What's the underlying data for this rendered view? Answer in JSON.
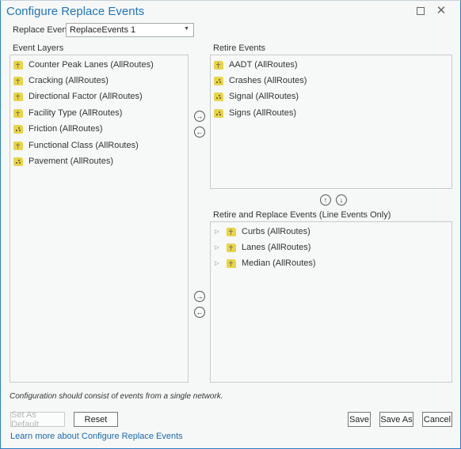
{
  "window": {
    "title": "Configure Replace Events"
  },
  "replace_events": {
    "label": "Replace Events",
    "selected": "ReplaceEvents 1"
  },
  "event_layers": {
    "header": "Event Layers",
    "items": [
      {
        "label": "Counter Peak Lanes (AllRoutes)",
        "icon": "line-event-layer-icon"
      },
      {
        "label": "Cracking (AllRoutes)",
        "icon": "line-event-layer-icon"
      },
      {
        "label": "Directional Factor (AllRoutes)",
        "icon": "line-event-layer-icon"
      },
      {
        "label": "Facility Type (AllRoutes)",
        "icon": "line-event-layer-icon"
      },
      {
        "label": "Friction (AllRoutes)",
        "icon": "point-event-layer-icon"
      },
      {
        "label": "Functional Class (AllRoutes)",
        "icon": "line-event-layer-icon"
      },
      {
        "label": "Pavement (AllRoutes)",
        "icon": "point-event-layer-icon"
      }
    ]
  },
  "retire_events": {
    "header": "Retire Events",
    "items": [
      {
        "label": "AADT (AllRoutes)",
        "icon": "line-event-layer-icon"
      },
      {
        "label": "Crashes (AllRoutes)",
        "icon": "point-event-layer-icon"
      },
      {
        "label": "Signal (AllRoutes)",
        "icon": "point-event-layer-icon"
      },
      {
        "label": "Signs (AllRoutes)",
        "icon": "point-event-layer-icon"
      }
    ]
  },
  "retire_replace_events": {
    "header": "Retire and Replace Events (Line Events Only)",
    "items": [
      {
        "label": "Curbs (AllRoutes)",
        "icon": "line-event-layer-icon"
      },
      {
        "label": "Lanes (AllRoutes)",
        "icon": "line-event-layer-icon"
      },
      {
        "label": "Median (AllRoutes)",
        "icon": "line-event-layer-icon"
      }
    ]
  },
  "arrows": {
    "right": "→",
    "left": "←",
    "up": "↑",
    "down": "↓"
  },
  "footer": {
    "note": "Configuration should consist of events from a single network.",
    "set_default": "Set As Default",
    "reset": "Reset",
    "save": "Save",
    "save_as": "Save As",
    "cancel": "Cancel",
    "learn_more": "Learn more about Configure Replace Events"
  },
  "colors": {
    "title": "#2276b9",
    "link": "#1c69ad",
    "layer_icon": "#e8d44a",
    "window_border": "#2a7fc4"
  }
}
